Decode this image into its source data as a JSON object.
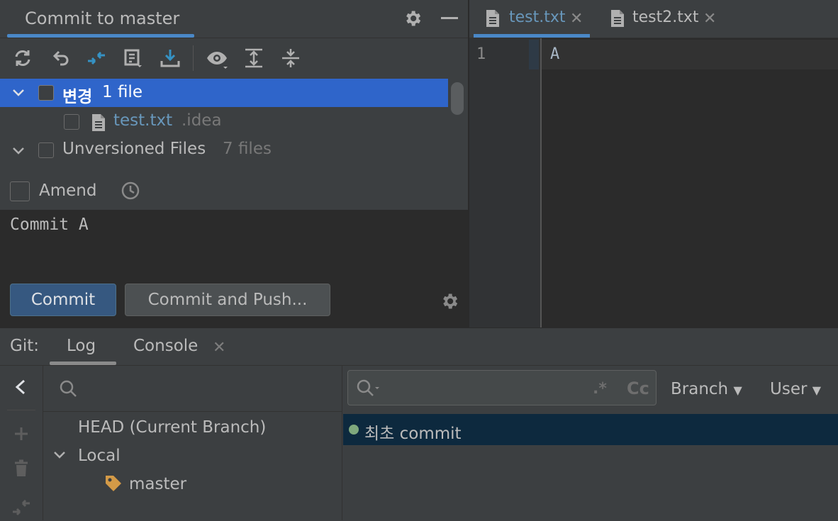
{
  "commit_panel": {
    "title": "Commit to master",
    "tree": {
      "changes_group": {
        "name": "변경",
        "count": "1 file"
      },
      "changed_file": {
        "name": "test.txt",
        "dir": ".idea"
      },
      "unversioned_group": {
        "name": "Unversioned Files",
        "count": "7 files"
      }
    },
    "amend_label": "Amend",
    "message": "Commit A",
    "commit_button": "Commit",
    "commit_push_button": "Commit and Push..."
  },
  "editor": {
    "tabs": [
      {
        "label": "test.txt",
        "active": true
      },
      {
        "label": "test2.txt",
        "active": false
      }
    ],
    "line_number": "1",
    "content": "A"
  },
  "git": {
    "prefix": "Git:",
    "tabs": {
      "log": "Log",
      "console": "Console"
    },
    "branches": {
      "head": "HEAD (Current Branch)",
      "local": "Local",
      "master": "master"
    },
    "log_filters": {
      "branch": "Branch",
      "user": "User"
    },
    "log_search_regex": ".*",
    "log_search_case": "Cc",
    "commits": [
      {
        "subject": "최초 commit"
      }
    ]
  },
  "colors": {
    "selection": "#2f65ca",
    "accent": "#4a88c7",
    "commit_row": "#0d293e",
    "tag": "#d39a47",
    "commit_dot": "#7fa87c"
  }
}
